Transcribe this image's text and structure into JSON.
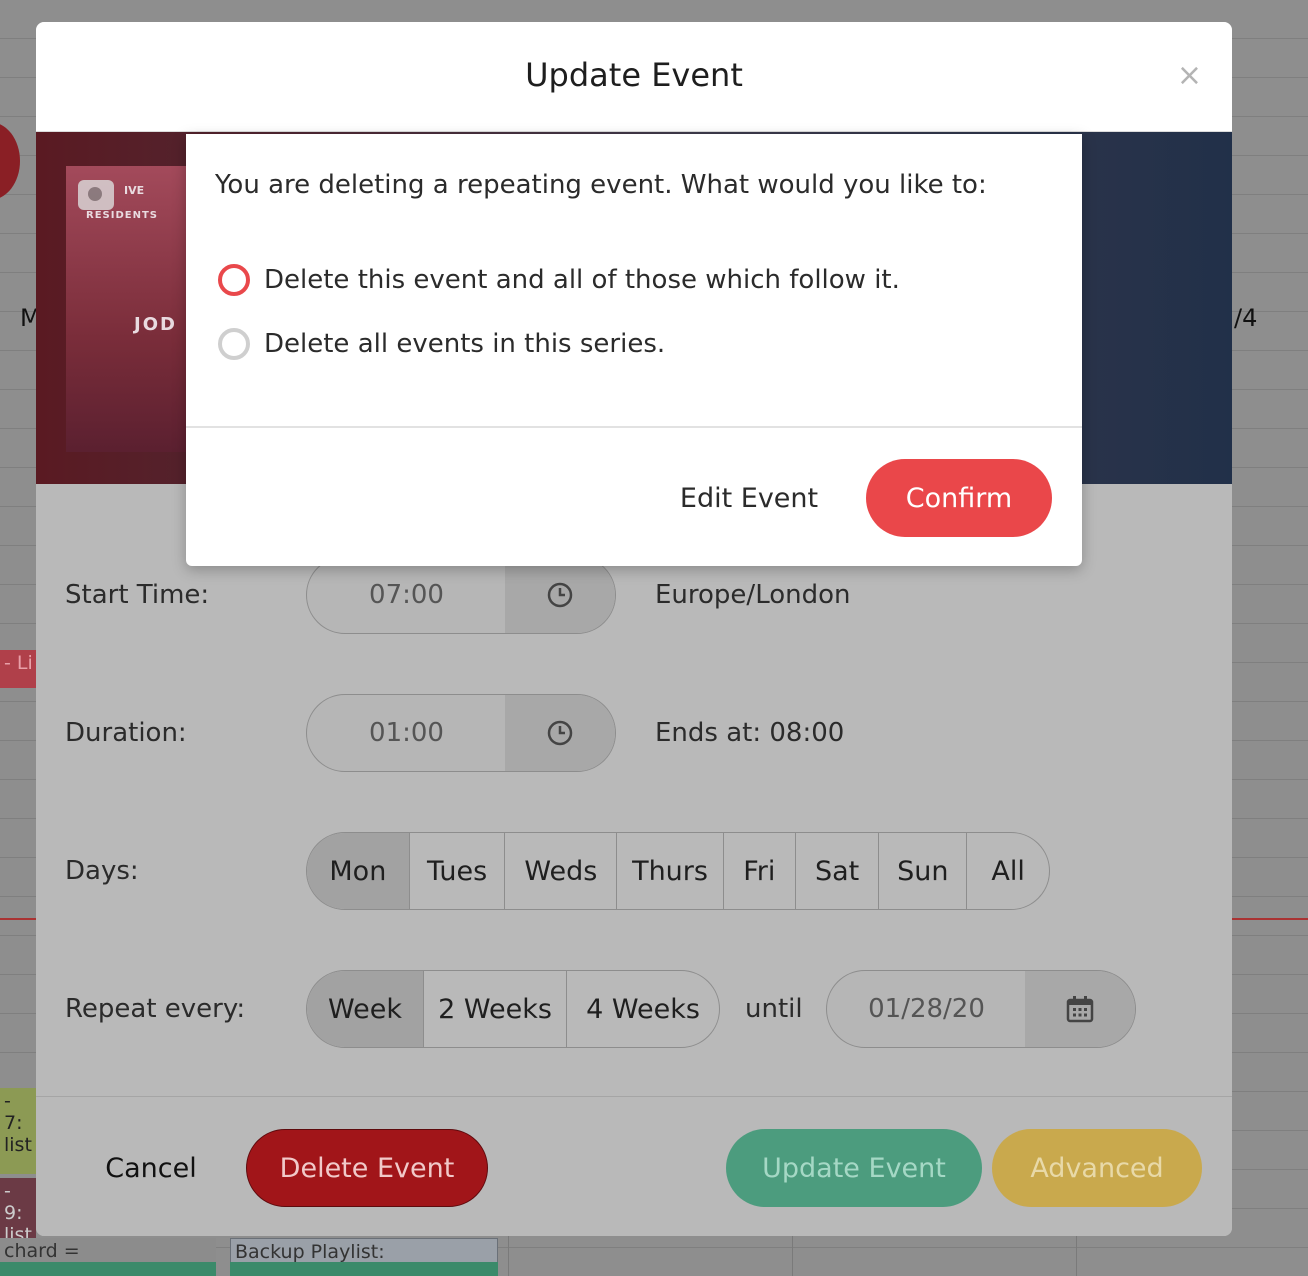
{
  "modal": {
    "title": "Update Event",
    "close_glyph": "×",
    "poster_text_1": "IVE",
    "poster_text_2": "RESIDENTS",
    "poster_text_3": "JOD"
  },
  "background": {
    "letter_left": "M",
    "letter_right": "/4",
    "event_1": "- Li",
    "event_2a": "- 7:",
    "event_2b": "list",
    "event_3a": "- 9:",
    "event_3b": "list",
    "event_4": "chard =",
    "event_5": "Backup Playlist:"
  },
  "form": {
    "start_time": {
      "label": "Start Time:",
      "value": "07:00",
      "timezone": "Europe/London"
    },
    "duration": {
      "label": "Duration:",
      "value": "01:00",
      "ends_at": "Ends at: 08:00"
    },
    "days": {
      "label": "Days:",
      "options": [
        "Mon",
        "Tues",
        "Weds",
        "Thurs",
        "Fri",
        "Sat",
        "Sun",
        "All"
      ],
      "selected": "Mon"
    },
    "repeat": {
      "label": "Repeat every:",
      "options": [
        "Week",
        "2 Weeks",
        "4 Weeks"
      ],
      "selected": "Week",
      "until_label": "until",
      "until_value": "01/28/20"
    }
  },
  "footer": {
    "cancel": "Cancel",
    "delete": "Delete Event",
    "update": "Update Event",
    "advanced": "Advanced"
  },
  "dialog": {
    "message": "You are deleting a repeating event. What would you like to:",
    "options": [
      {
        "label": "Delete this event and all of those which follow it.",
        "checked": true
      },
      {
        "label": "Delete all events in this series.",
        "checked": false
      }
    ],
    "edit_label": "Edit Event",
    "confirm_label": "Confirm"
  },
  "colors": {
    "confirm": "#ea474a",
    "delete": "#a11519",
    "update": "#4c9c7e",
    "advanced": "#c9a94d"
  }
}
